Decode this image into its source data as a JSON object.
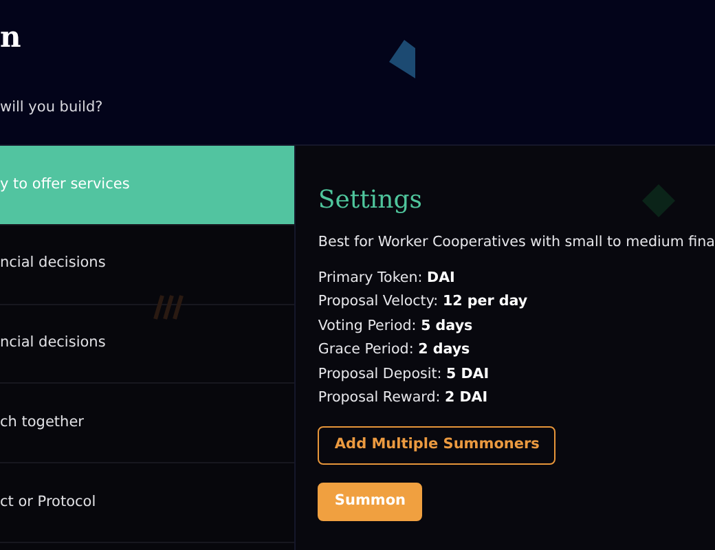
{
  "header": {
    "title": "n",
    "subtitle": "will you build?"
  },
  "options": [
    {
      "label": "y to offer services",
      "selected": true
    },
    {
      "label": "ncial decisions",
      "selected": false
    },
    {
      "label": "ncial decisions",
      "selected": false
    },
    {
      "label": "ch together",
      "selected": false
    },
    {
      "label": "ct or Protocol",
      "selected": false
    }
  ],
  "settings": {
    "title": "Settings",
    "description": "Best for Worker Cooperatives with small to medium fina",
    "items": [
      {
        "label": "Primary Token:",
        "value": "DAI"
      },
      {
        "label": "Proposal Velocty:",
        "value": "12 per day"
      },
      {
        "label": "Voting Period:",
        "value": "5 days"
      },
      {
        "label": "Grace Period:",
        "value": "2 days"
      },
      {
        "label": "Proposal Deposit:",
        "value": "5 DAI"
      },
      {
        "label": "Proposal Reward:",
        "value": "2 DAI"
      }
    ],
    "buttons": [
      {
        "label": "Add Multiple Summoners",
        "kind": "outline"
      },
      {
        "label": "Summon",
        "kind": "filled"
      }
    ]
  }
}
